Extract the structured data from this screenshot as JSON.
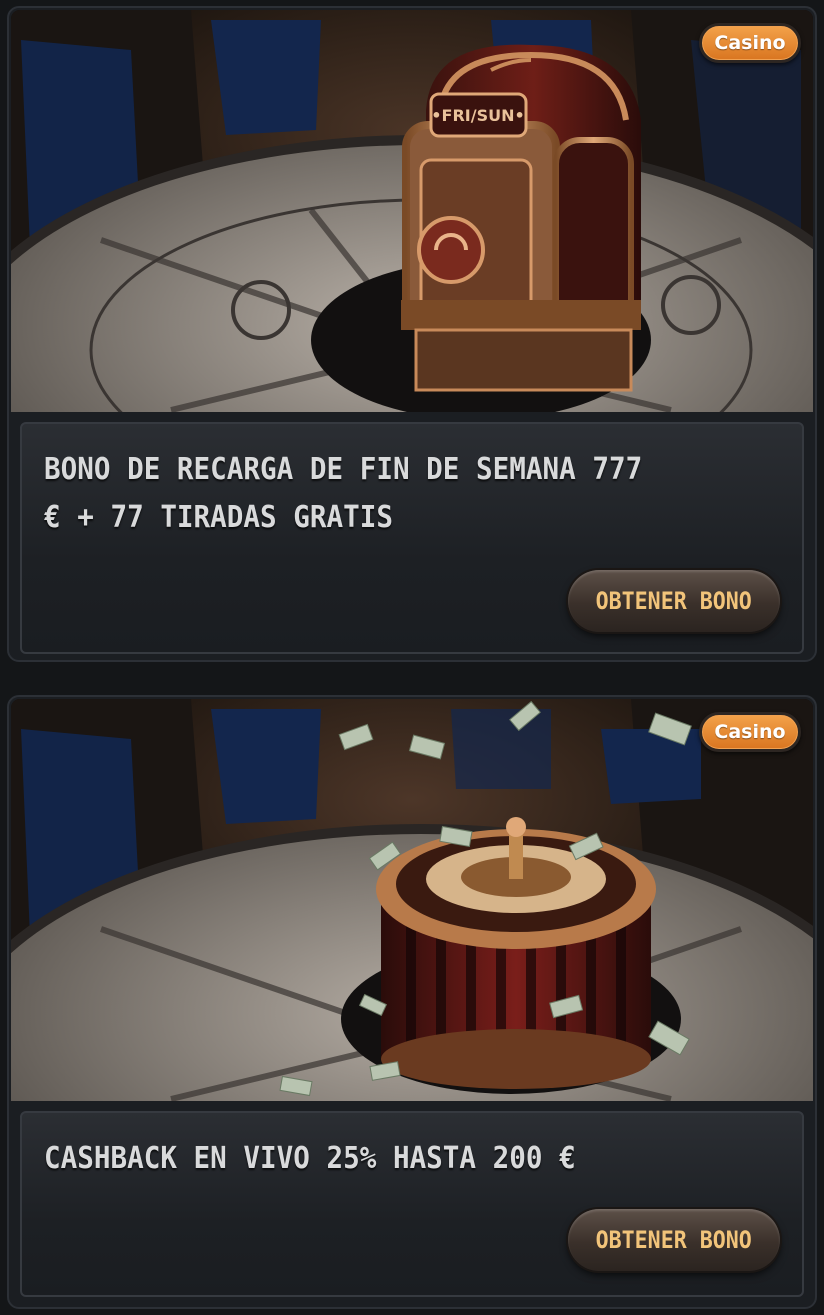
{
  "promotions": [
    {
      "badge": "Casino",
      "title": "BONO DE RECARGA DE FIN DE SEMANA 777 € + 77 TIRADAS GRATIS",
      "button": "OBTENER BONO",
      "image_label": "•FRI/SUN•"
    },
    {
      "badge": "Casino",
      "title": "CASHBACK EN VIVO 25% HASTA 200 €",
      "button": "OBTENER BONO"
    }
  ]
}
